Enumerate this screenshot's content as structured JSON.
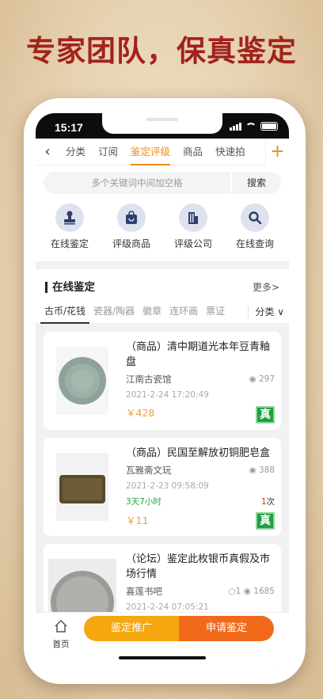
{
  "headline": "专家团队，保真鉴定",
  "status": {
    "time": "15:17"
  },
  "nav": {
    "tabs": [
      {
        "label": "分类"
      },
      {
        "label": "订阅"
      },
      {
        "label": "鉴定评级"
      },
      {
        "label": "商品"
      },
      {
        "label": "快速拍"
      }
    ],
    "active_tab": "鉴定评级"
  },
  "search": {
    "placeholder": "多个关键词中间加空格",
    "button": "搜索"
  },
  "quick_actions": [
    {
      "label": "在线鉴定",
      "icon": "stamp-icon"
    },
    {
      "label": "评级商品",
      "icon": "shopping-bag-icon"
    },
    {
      "label": "评级公司",
      "icon": "building-icon"
    },
    {
      "label": "在线查询",
      "icon": "magnifier-icon"
    }
  ],
  "section": {
    "title": "在线鉴定",
    "more": "更多>",
    "categories": [
      "古币/花钱",
      "瓷器/陶器",
      "徽章",
      "连环画",
      "票证"
    ],
    "sort_label": "分类"
  },
  "items": [
    {
      "title": "（商品）清中期道光本年豆青釉盘",
      "shop": "江南古瓷馆",
      "views": "297",
      "date": "2021-2-24 17:20:49",
      "price": "￥428",
      "badge": "真"
    },
    {
      "title": "（商品）民国至解放初铜肥皂盒",
      "shop": "瓦雅斋文玩",
      "views": "388",
      "date": "2021-2-23 09:58:09",
      "timer": "3天7小时",
      "bids_num": "1",
      "bids_unit": "次",
      "price": "￥11",
      "badge": "真"
    },
    {
      "title": "（论坛）鉴定此枚银币真假及市场行情",
      "shop": "喜莲书吧",
      "comments": "1",
      "views": "1685",
      "date": "2021-2-24 07:05:21"
    }
  ],
  "bottom": {
    "home": "首页",
    "promote": "鉴定推广",
    "apply": "申请鉴定"
  },
  "colors": {
    "accent": "#f08a18",
    "headline": "#a2221c",
    "authentic": "#1ea040"
  }
}
